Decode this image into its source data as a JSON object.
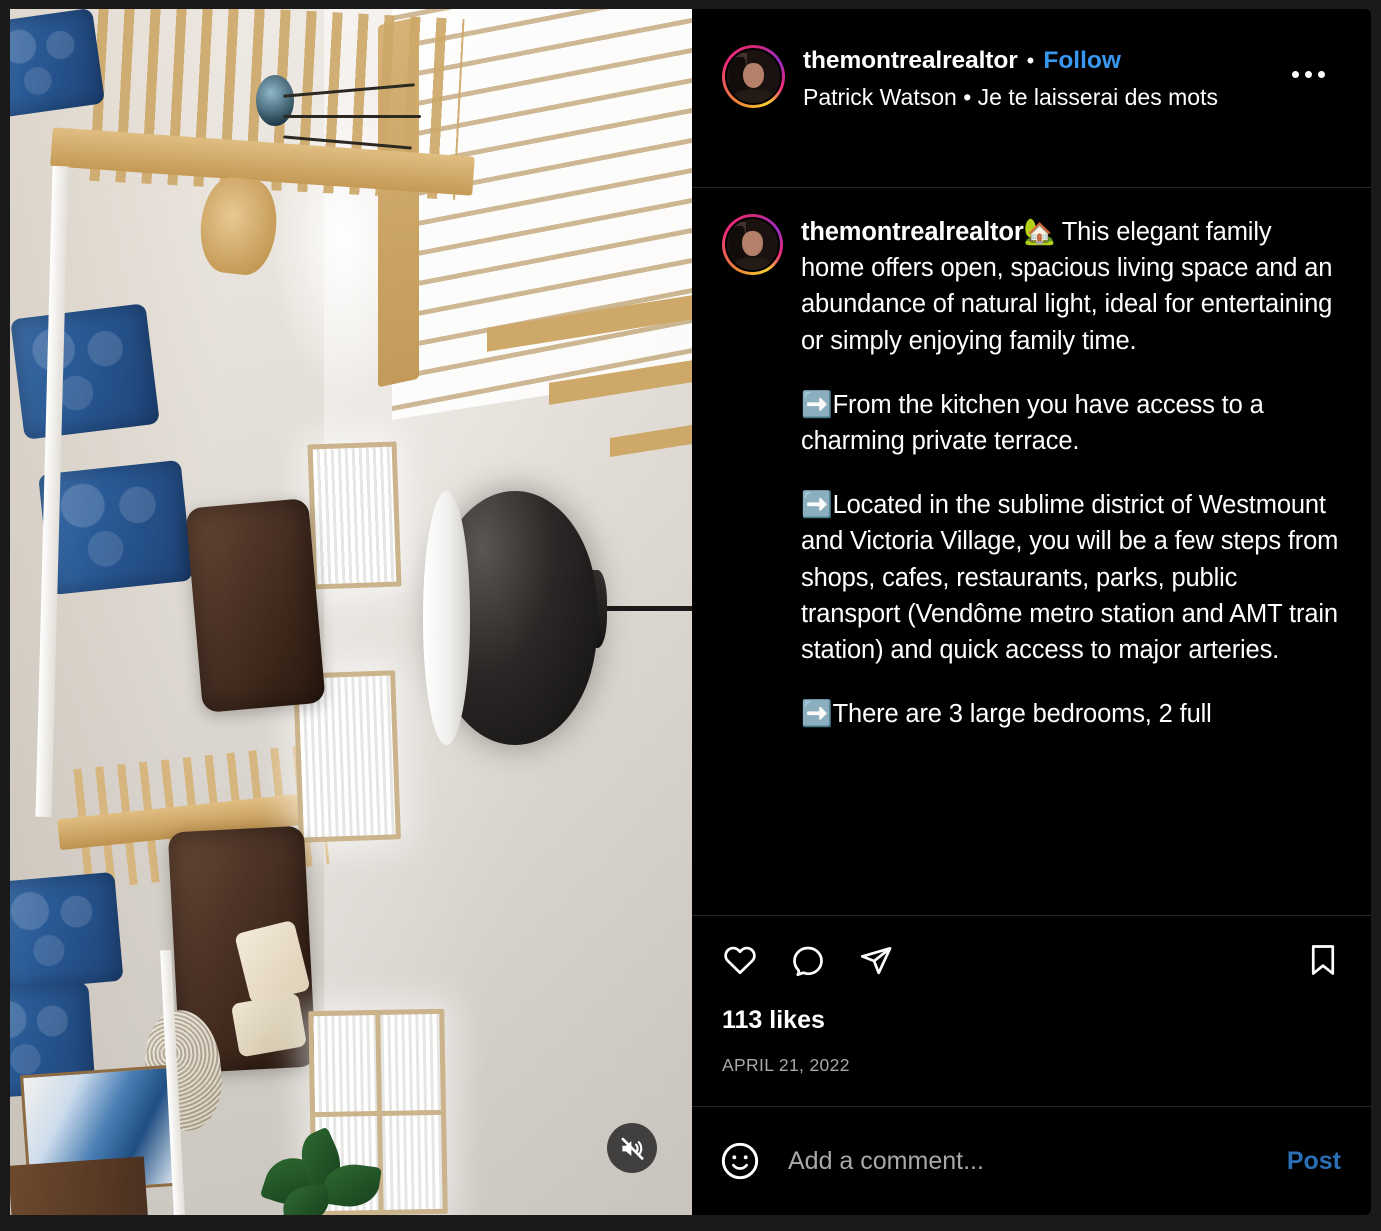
{
  "header": {
    "username": "themontrealrealtor",
    "separator": "•",
    "follow_label": "Follow",
    "audio_attribution": "Patrick Watson • Je te laisserai des mots",
    "more_options_label": "More options"
  },
  "caption": {
    "username": "themontrealrealtor",
    "house_emoji": "🏡",
    "arrow_emoji": "➡️",
    "paragraph_1": " This elegant family home offers open, spacious living space and an abundance of natural light, ideal for entertaining or simply enjoying family time.",
    "paragraph_2": "From the kitchen you have access to a charming private terrace.",
    "paragraph_3": "Located in the sublime district of Westmount and Victoria Village, you will be a few steps from shops, cafes, restaurants, parks, public transport (Vendôme metro station and AMT train station) and quick access to major arteries.",
    "paragraph_4": "There are 3 large bedrooms, 2 full"
  },
  "actions": {
    "like_label": "Like",
    "comment_label": "Comment",
    "share_label": "Share",
    "save_label": "Save"
  },
  "engagement": {
    "likes": "113 likes",
    "date": "APRIL 21, 2022"
  },
  "composer": {
    "placeholder": "Add a comment...",
    "value": "",
    "post_label": "Post"
  },
  "media": {
    "type": "video",
    "muted": true,
    "mute_label": "Audio is muted"
  },
  "colors": {
    "background": "#000000",
    "page_background": "#1a1a1a",
    "divider": "#262626",
    "link_blue": "#3897f0",
    "post_blue": "#2a6fb5",
    "muted_text": "#a8a8a8",
    "text": "#ffffff"
  }
}
